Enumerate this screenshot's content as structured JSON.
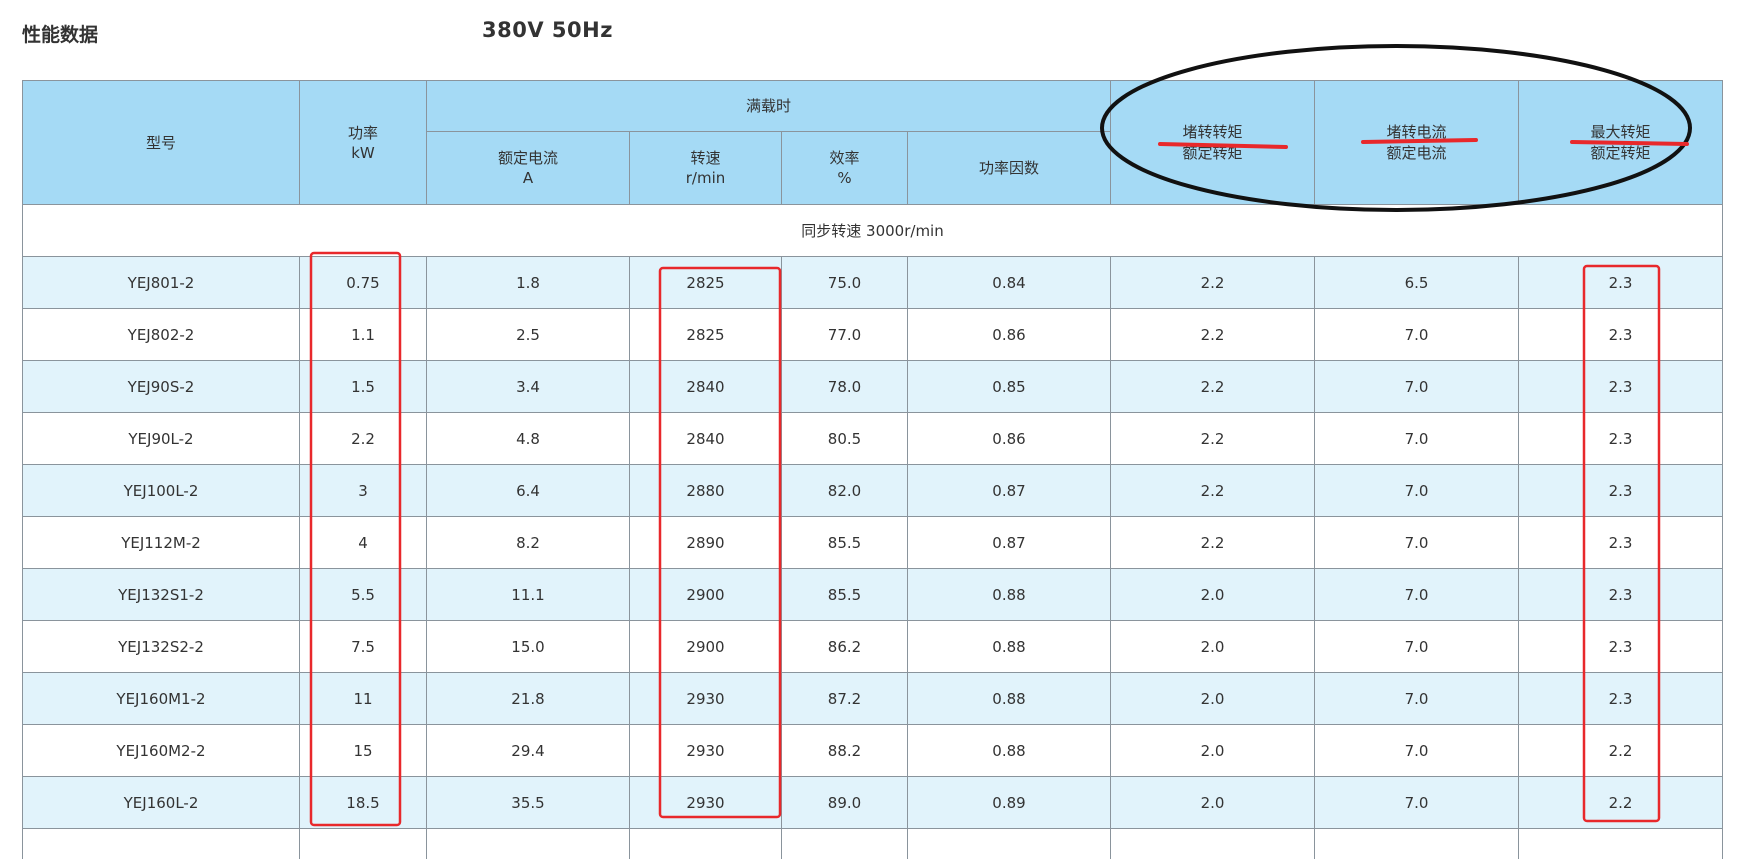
{
  "header": {
    "title": "性能数据",
    "spec": "380V  50Hz"
  },
  "table": {
    "columns": {
      "model": "型号",
      "power": [
        "功率",
        "kW"
      ],
      "full_load_group": "满载时",
      "rated_current": [
        "额定电流",
        "A"
      ],
      "speed": [
        "转速",
        "r/min"
      ],
      "efficiency": [
        "效率",
        "%"
      ],
      "power_factor": "功率因数",
      "locked_torque_ratio": [
        "堵转转矩",
        "额定转矩"
      ],
      "locked_current_ratio": [
        "堵转电流",
        "额定电流"
      ],
      "max_torque_ratio": [
        "最大转矩",
        "额定转矩"
      ]
    },
    "group_label": "同步转速  3000r/min",
    "rows": [
      [
        "YEJ801-2",
        "0.75",
        "1.8",
        "2825",
        "75.0",
        "0.84",
        "2.2",
        "6.5",
        "2.3"
      ],
      [
        "YEJ802-2",
        "1.1",
        "2.5",
        "2825",
        "77.0",
        "0.86",
        "2.2",
        "7.0",
        "2.3"
      ],
      [
        "YEJ90S-2",
        "1.5",
        "3.4",
        "2840",
        "78.0",
        "0.85",
        "2.2",
        "7.0",
        "2.3"
      ],
      [
        "YEJ90L-2",
        "2.2",
        "4.8",
        "2840",
        "80.5",
        "0.86",
        "2.2",
        "7.0",
        "2.3"
      ],
      [
        "YEJ100L-2",
        "3",
        "6.4",
        "2880",
        "82.0",
        "0.87",
        "2.2",
        "7.0",
        "2.3"
      ],
      [
        "YEJ112M-2",
        "4",
        "8.2",
        "2890",
        "85.5",
        "0.87",
        "2.2",
        "7.0",
        "2.3"
      ],
      [
        "YEJ132S1-2",
        "5.5",
        "11.1",
        "2900",
        "85.5",
        "0.88",
        "2.0",
        "7.0",
        "2.3"
      ],
      [
        "YEJ132S2-2",
        "7.5",
        "15.0",
        "2900",
        "86.2",
        "0.88",
        "2.0",
        "7.0",
        "2.3"
      ],
      [
        "YEJ160M1-2",
        "11",
        "21.8",
        "2930",
        "87.2",
        "0.88",
        "2.0",
        "7.0",
        "2.3"
      ],
      [
        "YEJ160M2-2",
        "15",
        "29.4",
        "2930",
        "88.2",
        "0.88",
        "2.0",
        "7.0",
        "2.2"
      ],
      [
        "YEJ160L-2",
        "18.5",
        "35.5",
        "2930",
        "89.0",
        "0.89",
        "2.0",
        "7.0",
        "2.2"
      ]
    ]
  },
  "annotations": {
    "box_color": "#e8282b",
    "ellipse_color": "#111111",
    "highlight_color": "#e8282b"
  }
}
